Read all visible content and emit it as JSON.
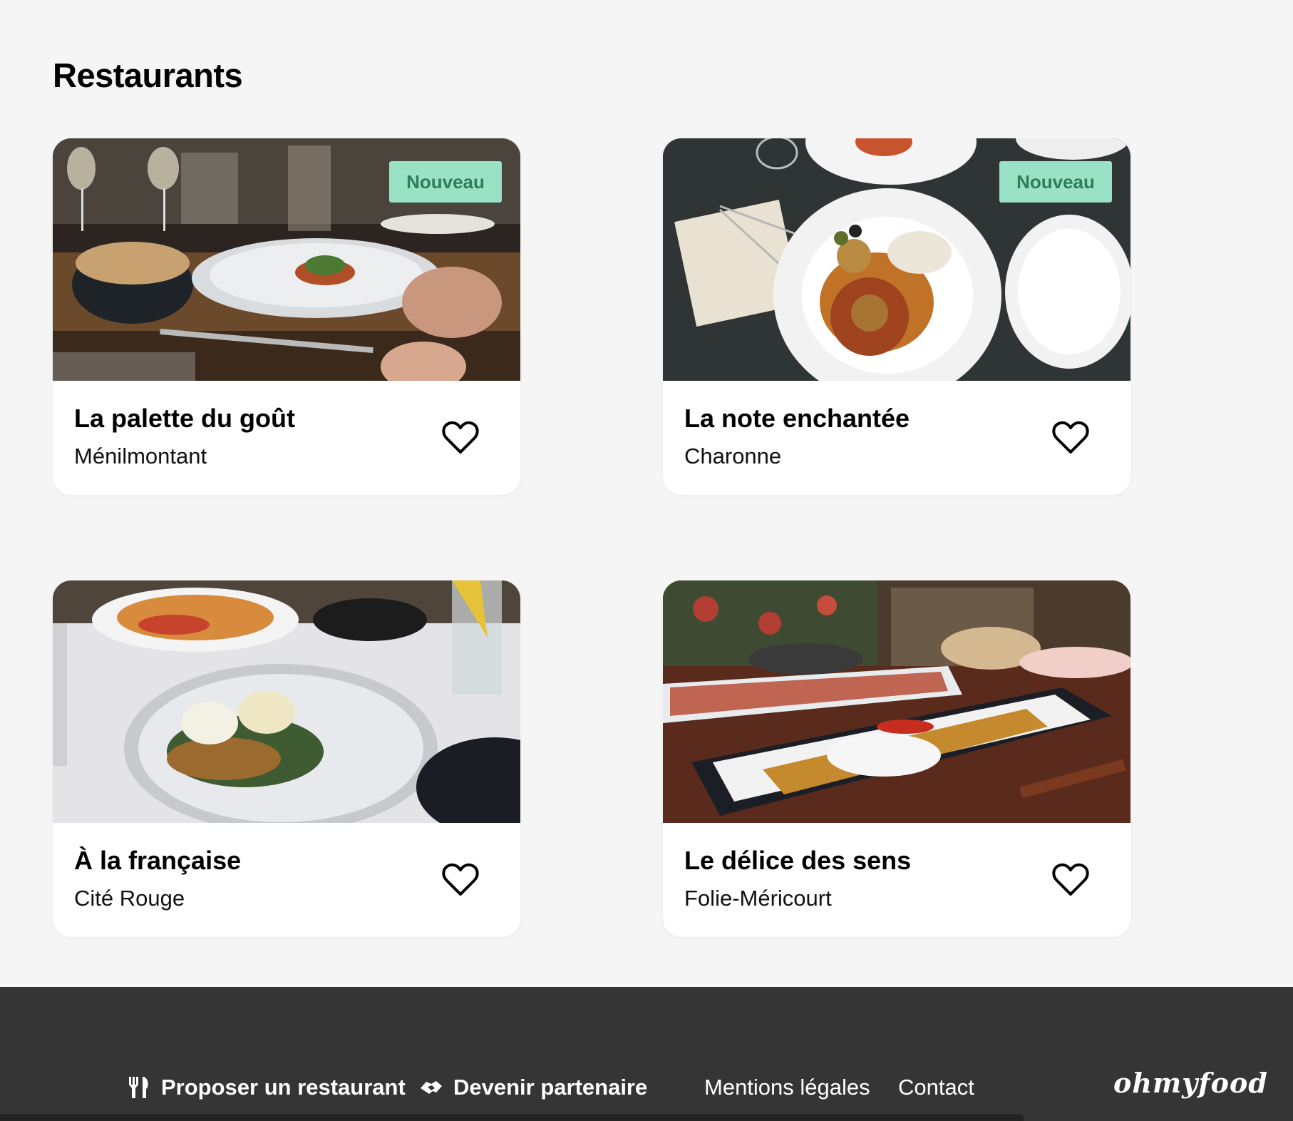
{
  "page": {
    "title": "Restaurants"
  },
  "restaurants": [
    {
      "name": "La palette du goût",
      "location": "Ménilmontant",
      "badge": "Nouveau",
      "favorite": false
    },
    {
      "name": "La note enchantée",
      "location": "Charonne",
      "badge": "Nouveau",
      "favorite": false
    },
    {
      "name": "À la française",
      "location": "Cité Rouge",
      "badge": "",
      "favorite": false
    },
    {
      "name": "Le délice des sens",
      "location": "Folie-Méricourt",
      "badge": "",
      "favorite": false
    }
  ],
  "footer": {
    "propose_label": "Proposer un restaurant",
    "propose_icon": "fork-knife-icon",
    "partner_label": "Devenir partenaire",
    "partner_icon": "handshake-icon",
    "legal_label": "Mentions légales",
    "contact_label": "Contact",
    "logo": "ohmyfood"
  },
  "colors": {
    "background": "#f5f5f5",
    "badge_bg": "#99e2c6",
    "badge_text": "#2e7d5b",
    "footer_bg": "#353535"
  }
}
